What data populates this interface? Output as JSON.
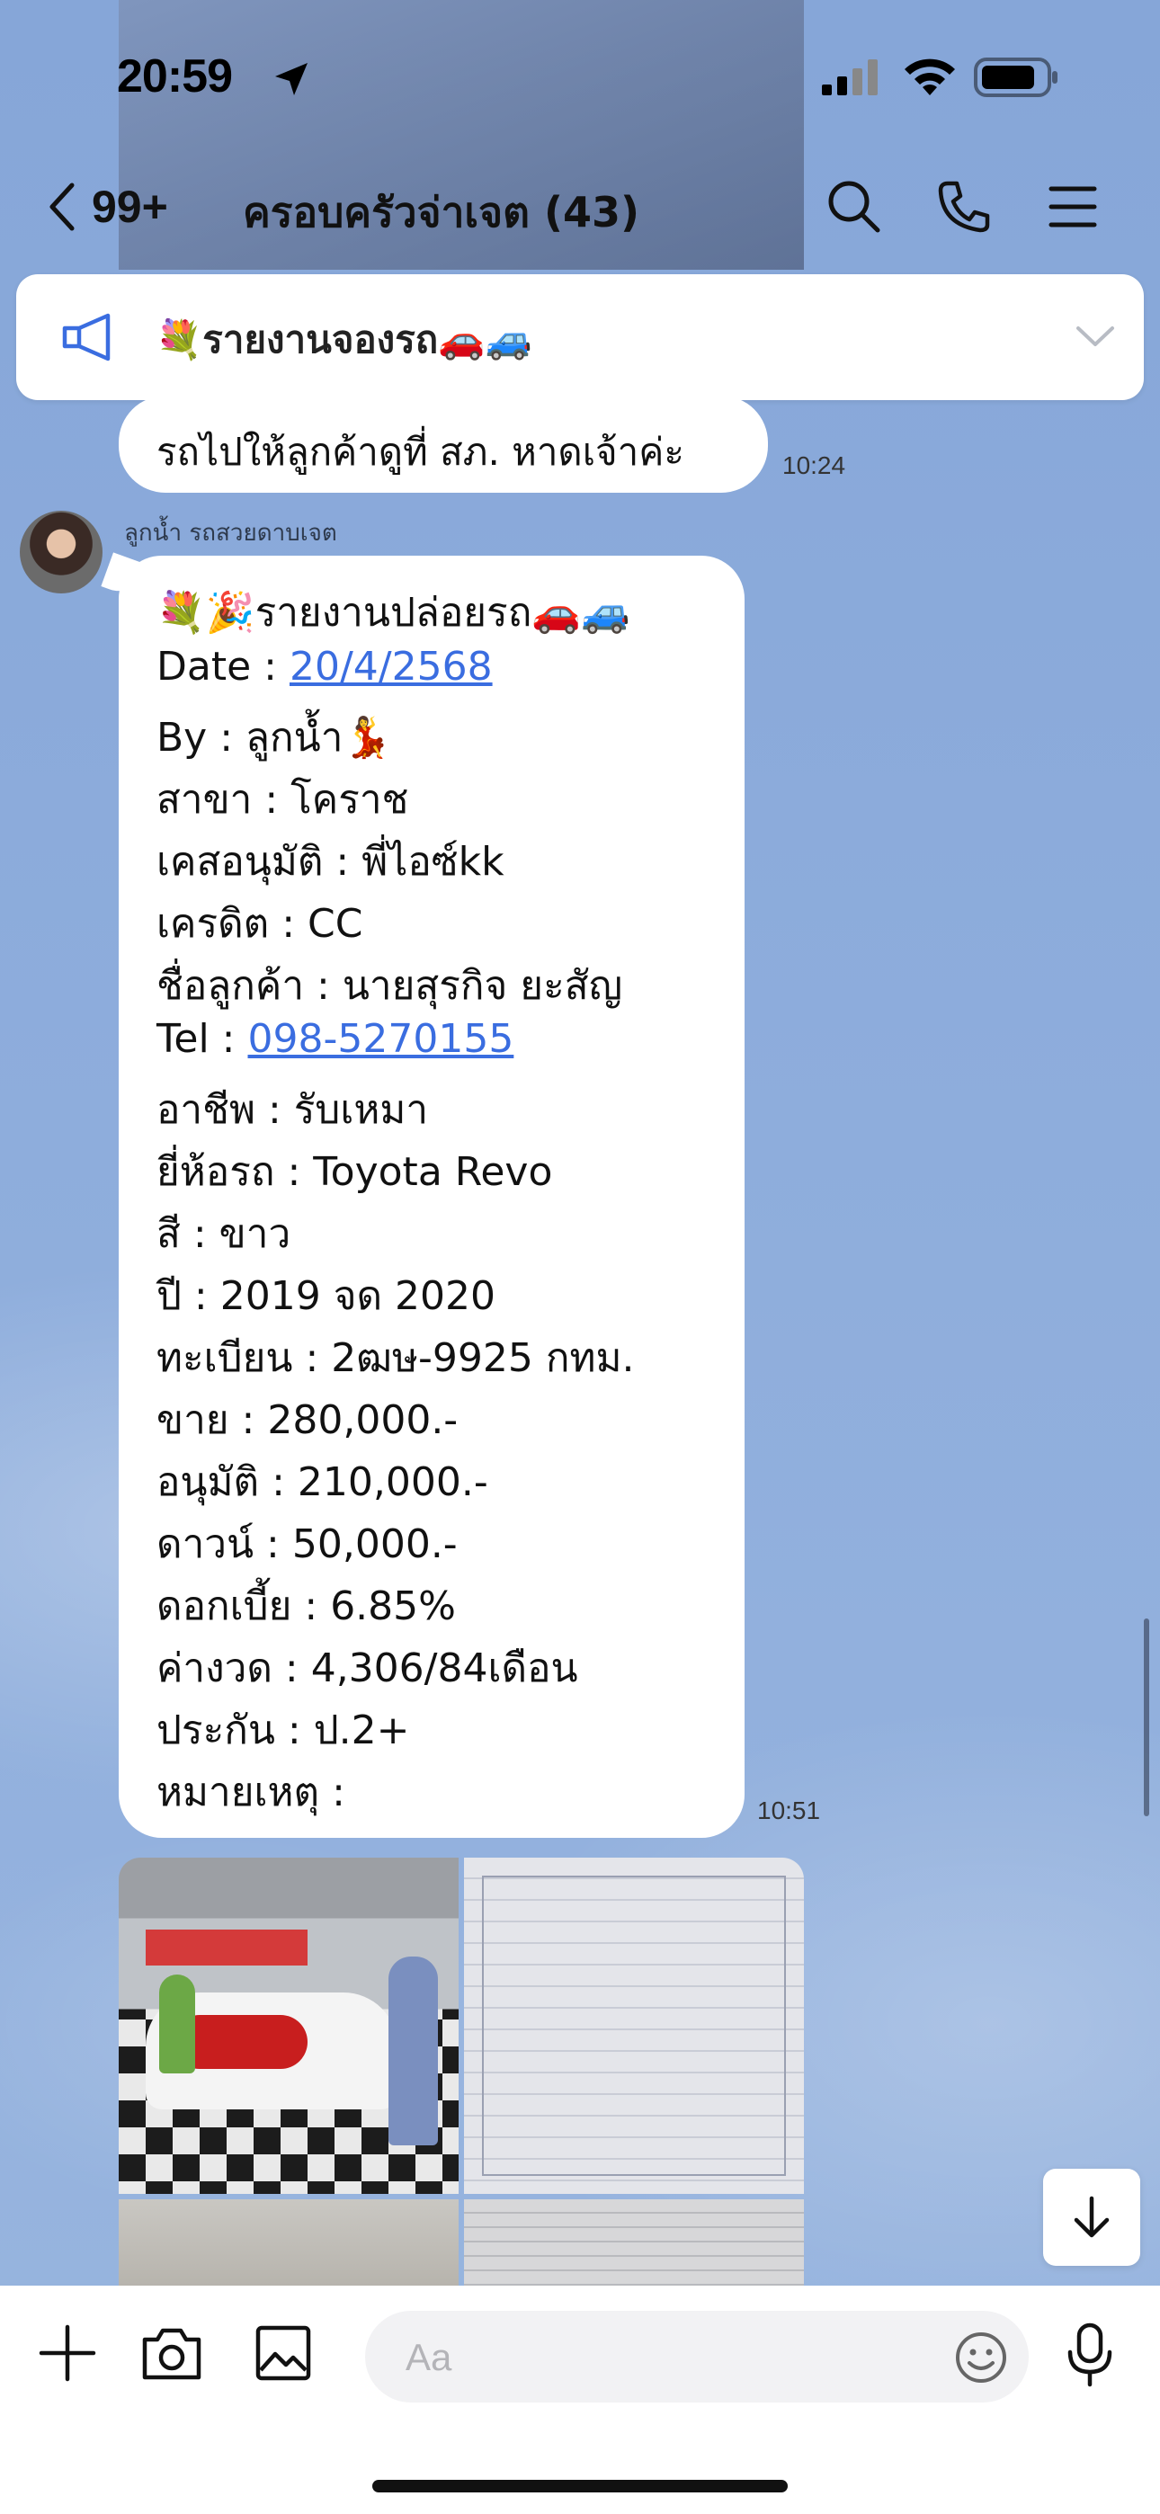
{
  "status": {
    "time": "20:59"
  },
  "nav": {
    "back_count": "99+",
    "title": "ครอบครัวจ่าเจต (43)"
  },
  "announcement": {
    "text": "💐รายงานจองรถ🚗🚙"
  },
  "messages": [
    {
      "text": "รถไปให้ลูกค้าดูที่ สภ. หาดเจ้าค่ะ",
      "time": "10:24"
    },
    {
      "sender": "ลูกน้ำ รถสวยดาบเจต",
      "time": "10:51",
      "title": "💐🎉รายงานปล่อยรถ🚗🚙",
      "date_label": "Date : ",
      "date_value": "20/4/2568",
      "by": "By : ลูกน้ำ💃",
      "branch": "สาขา : โคราช",
      "approver": "เคสอนุมัติ : พี่ไอซ์kk",
      "credit": "เครดิต : CC",
      "customer": "ชื่อลูกค้า : นายสุรกิจ ยะสัญ",
      "tel_label": "Tel : ",
      "tel_value": "098-5270155",
      "job": "อาชีพ : รับเหมา",
      "brand": "ยี่ห้อรถ : Toyota Revo",
      "color": "สี : ขาว",
      "year": "ปี : 2019 จด 2020",
      "plate": "ทะเบียน : 2ฒษ-9925 กทม.",
      "sale": "ขาย : 280,000.-",
      "approved": "อนุมัติ : 210,000.-",
      "down": "ดาวน์ : 50,000.-",
      "interest": "ดอกเบี้ย : 6.85%",
      "installment": "ค่างวด : 4,306/84เดือน",
      "insurance": "ประกัน : ป.2+",
      "note": "หมายเหตุ :"
    }
  ],
  "input": {
    "placeholder": "Aa"
  },
  "colors": {
    "background": "#8faedb",
    "bubble": "#ffffff",
    "link": "#3a6de0"
  }
}
